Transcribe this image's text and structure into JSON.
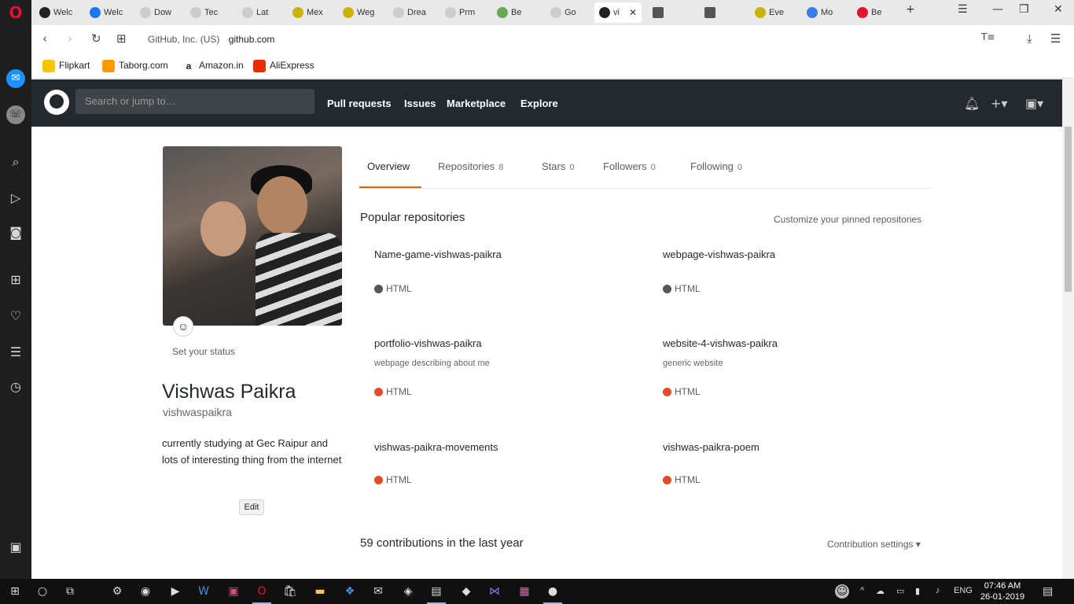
{
  "browser": {
    "tabs": [
      {
        "label": "Welc",
        "color": "#222"
      },
      {
        "label": "Welc",
        "color": "#1877f2"
      },
      {
        "label": "Dow",
        "color": "#aaa"
      },
      {
        "label": "Tec",
        "color": "#aaa"
      },
      {
        "label": "Lat",
        "color": "#aaa"
      },
      {
        "label": "Mex",
        "color": "#c9b400"
      },
      {
        "label": "Weg",
        "color": "#c9b400"
      },
      {
        "label": "Drea",
        "color": "#aaa"
      },
      {
        "label": "Prm",
        "color": "#aaa"
      },
      {
        "label": "Be",
        "color": "#6a5"
      },
      {
        "label": "Go",
        "color": "#aaa"
      },
      {
        "label": "vi",
        "color": "#222"
      },
      {
        "label": "",
        "color": "#555"
      },
      {
        "label": "",
        "color": "#555"
      },
      {
        "label": "Eve",
        "color": "#c9b400"
      },
      {
        "label": "Mo",
        "color": "#3c7de8"
      },
      {
        "label": "Be",
        "color": "#e0142e"
      }
    ],
    "new_tab": "+",
    "address": {
      "cert": "GitHub, Inc. (US)",
      "domain": "github.com"
    },
    "bookmarks": [
      {
        "label": "Flipkart",
        "color": "#f7c600"
      },
      {
        "label": "Taborg.com",
        "color": "#ff9900"
      },
      {
        "label": "Amazon.in",
        "color": "#222"
      },
      {
        "label": "AliExpress",
        "color": "#e62e04"
      }
    ]
  },
  "github": {
    "search_placeholder": "Search or jump to…",
    "nav": [
      "Pull requests",
      "Issues",
      "Marketplace",
      "Explore"
    ],
    "profile": {
      "fullname": "Vishwas Paikra",
      "username": "vishwaspaikra",
      "status": "Set your status",
      "bio": "currently studying at Gec Raipur and lots of interesting thing from the internet",
      "edit": "Edit"
    },
    "tabs": [
      {
        "label": "Overview",
        "count": ""
      },
      {
        "label": "Repositories",
        "count": "8"
      },
      {
        "label": "Stars",
        "count": "0"
      },
      {
        "label": "Followers",
        "count": "0"
      },
      {
        "label": "Following",
        "count": "0"
      }
    ],
    "popular_title": "Popular repositories",
    "customize_link": "Customize your pinned repositories",
    "repos": [
      {
        "name": "Name-game-vishwas-paikra",
        "desc": "",
        "lang": "HTML",
        "color": "#555"
      },
      {
        "name": "webpage-vishwas-paikra",
        "desc": "",
        "lang": "HTML",
        "color": "#555"
      },
      {
        "name": "portfolio-vishwas-paikra",
        "desc": "webpage describing about me",
        "lang": "HTML",
        "color": "#e34c26"
      },
      {
        "name": "website-4-vishwas-paikra",
        "desc": "generic website",
        "lang": "HTML",
        "color": "#e34c26"
      },
      {
        "name": "vishwas-paikra-movements",
        "desc": "",
        "lang": "HTML",
        "color": "#e34c26"
      },
      {
        "name": "vishwas-paikra-poem",
        "desc": "",
        "lang": "HTML",
        "color": "#e34c26"
      }
    ],
    "contributions_title": "59 contributions in the last year",
    "contrib_settings": "Contribution settings ▾"
  },
  "taskbar": {
    "language": "ENG",
    "time": "07:46 AM",
    "date": "26-01-2019"
  }
}
